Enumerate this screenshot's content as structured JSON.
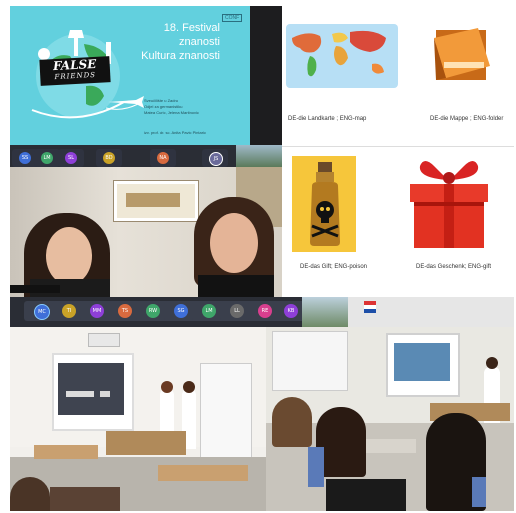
{
  "slide": {
    "line1": "18. Festival",
    "line2": "znanosti",
    "line3": "Kultura znanosti",
    "logo_word1": "FALSE",
    "logo_word2": "FRIENDS",
    "authors_line1": "Sveučilište u Zadru",
    "authors_line2": "Odjel za germanistiku",
    "authors_line3": "Matea Curic, Jelena Martinovic",
    "mentor": "izv. prof. dr. sc. Anita Pavic Pintaric",
    "corner_badge": "CONF"
  },
  "participants_top": [
    "SS",
    "LM",
    "SL",
    "BD",
    "NA",
    "JS"
  ],
  "participants_bottom": [
    "MC",
    "TI",
    "MM",
    "TS",
    "RW",
    "SG",
    "LM",
    "LL",
    "RE",
    "KB"
  ],
  "vocab": [
    {
      "caption": "DE-die Landkarte ; ENG-map",
      "icon": "world-map-icon"
    },
    {
      "caption": "DE-die Mappe ; ENG-folder",
      "icon": "folder-icon"
    },
    {
      "caption": "DE-das Gift;    ENG-poison",
      "icon": "poison-bottle-icon"
    },
    {
      "caption": "DE-das Geschenk;    ENG-gift",
      "icon": "gift-box-icon"
    }
  ],
  "avatar_colors": [
    "#3f6fd8",
    "#c9a227",
    "#8e3fd8",
    "#d86a3f",
    "#3fa66a",
    "#d83f8e",
    "#6a6a6a"
  ]
}
